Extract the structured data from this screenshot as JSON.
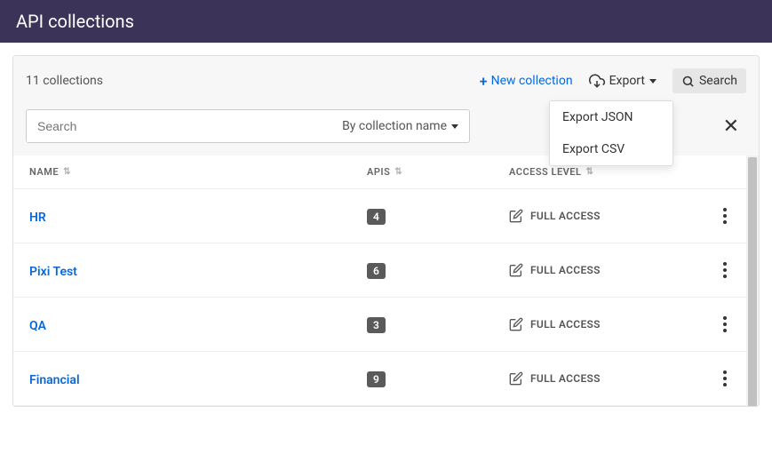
{
  "header": {
    "title": "API collections"
  },
  "toolbar": {
    "count_text": "11 collections",
    "new_label": "New collection",
    "export_label": "Export",
    "search_label": "Search",
    "export_menu": {
      "json": "Export JSON",
      "csv": "Export CSV"
    }
  },
  "search": {
    "placeholder": "Search",
    "filter_label": "By collection name"
  },
  "columns": {
    "name": "NAME",
    "apis": "APIS",
    "access": "ACCESS LEVEL"
  },
  "rows": [
    {
      "name": "HR",
      "apis": "4",
      "access": "FULL ACCESS"
    },
    {
      "name": "Pixi Test",
      "apis": "6",
      "access": "FULL ACCESS"
    },
    {
      "name": "QA",
      "apis": "3",
      "access": "FULL ACCESS"
    },
    {
      "name": "Financial",
      "apis": "9",
      "access": "FULL ACCESS"
    }
  ]
}
